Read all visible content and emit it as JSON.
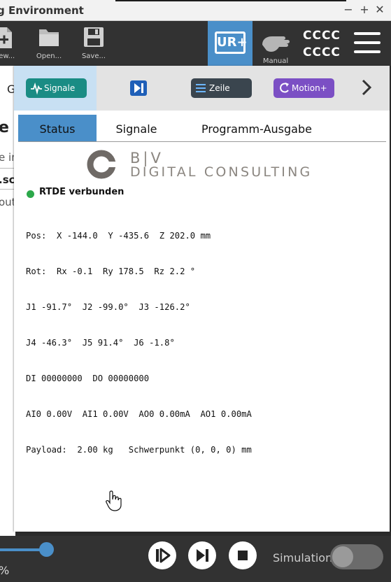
{
  "window": {
    "title": "g Environment",
    "minimize": "−",
    "maximize": "+",
    "close": "✕"
  },
  "toolbar": {
    "new_label": "New...",
    "open_label": "Open...",
    "save_label": "Save...",
    "ur_label": "UR+",
    "manual_label": "Manual",
    "status_line1": "CCCC",
    "status_line2": "CCCC"
  },
  "underlying": {
    "fragments": [
      "G",
      "e",
      "e in",
      ".sc",
      "out"
    ]
  },
  "panel": {
    "pills": {
      "signale": "Signale",
      "zeile": "Zeile",
      "motion": "Motion+"
    },
    "tabs": {
      "status": "Status",
      "signale": "Signale",
      "program_output": "Programm-Ausgabe"
    },
    "logo": {
      "top": "B|V",
      "bottom": "DIGITAL CONSULTING"
    },
    "connection": "RTDE verbunden",
    "status_lines": [
      "Pos:  X -144.0  Y -435.6  Z 202.0 mm",
      "Rot:  Rx -0.1  Ry 178.5  Rz 2.2 °",
      "J1 -91.7°  J2 -99.0°  J3 -126.2°",
      "J4 -46.3°  J5 91.4°  J6 -1.8°",
      "DI 00000000  DO 00000000",
      "AI0 0.00V  AI1 0.00V  AO0 0.00mA  AO1 0.00mA",
      "Payload:  2.00 kg   Schwerpunkt (0, 0, 0) mm"
    ]
  },
  "bottom": {
    "speed_suffix": "%",
    "simulation_label": "Simulation",
    "simulation_on": false
  },
  "colors": {
    "accent": "#4a8fc9",
    "signale_pill": "#1a8c84",
    "zeile_pill": "#3a454e",
    "motion_pill": "#7b4fc4",
    "connected": "#2ca84a"
  },
  "icons": [
    "new-file-icon",
    "folder-icon",
    "floppy-save-icon",
    "ur-plus-icon",
    "hand-icon",
    "hamburger-menu-icon",
    "signal-wave-icon",
    "step-forward-icon",
    "list-icon",
    "rotate-icon",
    "chevron-right-icon",
    "play-icon",
    "step-icon",
    "stop-icon"
  ]
}
